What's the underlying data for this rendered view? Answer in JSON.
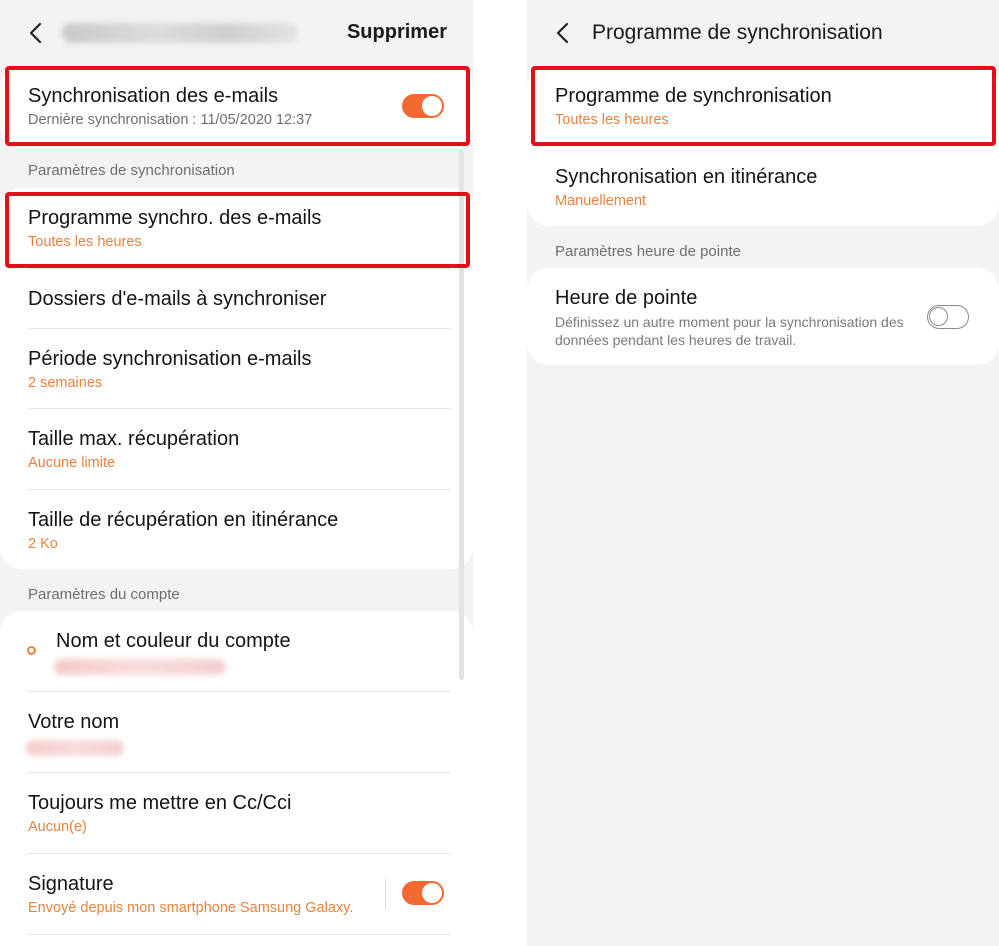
{
  "left": {
    "header": {
      "action_label": "Supprimer"
    },
    "sync_emails": {
      "title": "Synchronisation des e-mails",
      "subtitle": "Dernière synchronisation : 11/05/2020  12:37",
      "enabled": true
    },
    "sync_settings_section": "Paramètres de synchronisation",
    "sync_items": [
      {
        "title": "Programme synchro. des e-mails",
        "value": "Toutes les heures"
      },
      {
        "title": "Dossiers d'e-mails à synchroniser",
        "value": ""
      },
      {
        "title": "Période synchronisation e-mails",
        "value": "2 semaines"
      },
      {
        "title": "Taille max. récupération",
        "value": "Aucune limite"
      },
      {
        "title": "Taille de récupération en itinérance",
        "value": "2 Ko"
      }
    ],
    "account_section": "Paramètres du compte",
    "account_items": [
      {
        "title": "Nom et couleur du compte",
        "value": ""
      },
      {
        "title": "Votre nom",
        "value": ""
      },
      {
        "title": "Toujours me mettre en Cc/Cci",
        "value": "Aucun(e)"
      },
      {
        "title": "Signature",
        "value": "Envoyé depuis mon smartphone Samsung Galaxy.",
        "enabled": true
      }
    ]
  },
  "right": {
    "header": {
      "title": "Programme de synchronisation"
    },
    "schedule_items": [
      {
        "title": "Programme de synchronisation",
        "value": "Toutes les heures"
      },
      {
        "title": "Synchronisation en itinérance",
        "value": "Manuellement"
      }
    ],
    "peak_section": "Paramètres heure de pointe",
    "peak": {
      "title": "Heure de pointe",
      "description": "Définissez un autre moment pour la synchronisation des données pendant les heures de travail.",
      "enabled": false
    }
  },
  "colors": {
    "accent_orange": "#f26a32",
    "value_orange": "#e8823f",
    "highlight_red": "#e3101c",
    "background_grey": "#f3f3f3"
  },
  "icons": {
    "back": "chevron-left-icon",
    "account_color": "circle-outline-icon"
  }
}
